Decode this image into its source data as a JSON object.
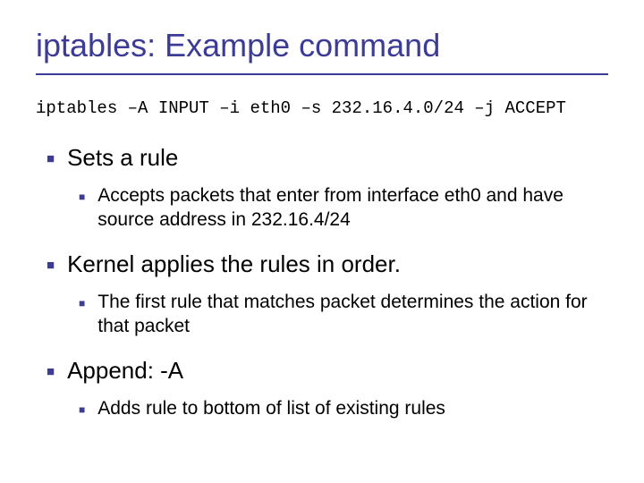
{
  "title": "iptables: Example command",
  "command": "iptables –A INPUT –i eth0 –s 232.16.4.0/24 –j ACCEPT",
  "bullets": [
    {
      "text": "Sets a rule",
      "sub": [
        "Accepts packets that enter from interface eth0 and have source address in 232.16.4/24"
      ]
    },
    {
      "text": "Kernel applies the rules in order.",
      "sub": [
        "The first rule that matches packet determines the action for that packet"
      ]
    },
    {
      "text": "Append: -A",
      "sub": [
        "Adds rule to bottom of list of existing rules"
      ]
    }
  ]
}
